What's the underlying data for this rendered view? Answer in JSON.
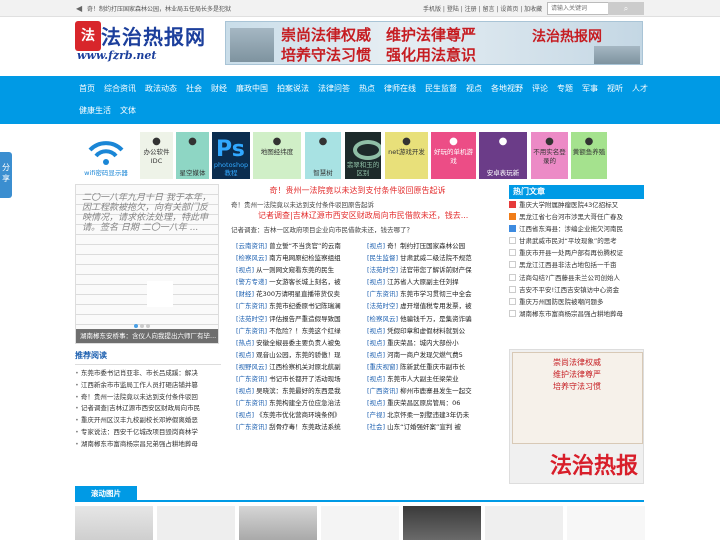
{
  "topbar": {
    "notice": "奇！制约打压国家森林公园，林业局五任局长多是犯狱",
    "links": "手机版 | 登陆 | 注册 | 留言 | 设首页 | 加收藏",
    "search_placeholder": "请输入关键词",
    "search_icon": "search-icon",
    "speaker_icon": "speaker-icon"
  },
  "logo": {
    "mark": "法",
    "name": "法治热报网",
    "url": "www.fzrb.net"
  },
  "banner": {
    "line1": "崇尚法律权威　维护法律尊严",
    "line2": "培养守法习惯　强化用法意识",
    "side": "法治热报网"
  },
  "nav": {
    "row1": [
      "首页",
      "综合资讯",
      "政法动态",
      "社会",
      "财经",
      "廉政中国",
      "拍案说法",
      "法律问答",
      "热点",
      "律师在线",
      "民生监督",
      "视点",
      "各地视野",
      "评论",
      "专题",
      "军事",
      "视听",
      "人才"
    ],
    "row2": [
      "健康生活",
      "文体"
    ]
  },
  "share": "分享",
  "tiles": [
    {
      "label": "wifi密码显示器",
      "icon": "wifi-icon",
      "bg": "#ffffff",
      "fg": "#1a86d6"
    },
    {
      "label": "办公软件\nIDC",
      "icon": "office-icon",
      "bg": "#eef3e8",
      "fg": "#333333"
    },
    {
      "label": "星空媒体",
      "icon": "star-icon",
      "bg": "#8ed6c4",
      "fg": "#333333"
    },
    {
      "label": "photoshop教程",
      "icon": "photoshop-icon",
      "bg": "#0b2d4f",
      "fg": "#31a8ff"
    },
    {
      "label": "地图经纬度",
      "icon": "map-icon",
      "bg": "#d0efc7",
      "fg": "#333333"
    },
    {
      "label": "智慧树",
      "icon": "tree-icon",
      "bg": "#a8e2e3",
      "fg": "#333333"
    },
    {
      "label": "翡翠和玉的区别",
      "icon": "jade-icon",
      "bg": "#1d2a2a",
      "fg": "#8fbfa6"
    },
    {
      "label": "net游戏开发",
      "icon": "game-dev-icon",
      "bg": "#e8e07a",
      "fg": "#333333"
    },
    {
      "label": "好玩的单机游戏",
      "icon": "game-icon",
      "bg": "#ec4d86",
      "fg": "#ffffff"
    },
    {
      "label": "安卓表玩新",
      "icon": "android-icon",
      "bg": "#6b3c88",
      "fg": "#ffffff"
    },
    {
      "label": "不用实名登录的",
      "icon": "login-icon",
      "bg": "#ec8ac6",
      "fg": "#333333"
    },
    {
      "label": "黄额鱼养殖",
      "icon": "fish-icon",
      "bg": "#a5e28e",
      "fg": "#333333"
    }
  ],
  "headline": {
    "title1": "奇！贵州一法院竟以未达到支付条件驳回原告起诉",
    "desc1": "奇！贵州一法院竟以未达到支付条件驳回原告起诉",
    "title2": "记者调查|吉林辽源市西安区财政局向市民借款未还，钱去...",
    "desc2": "记者调查：吉林一区政府项目企业向市民借款未还，钱去哪了？"
  },
  "slide": {
    "caption": "湖南郴东安桥事：含仪人向我提出六师厂有毕...",
    "scrawl": "二〇一八年九月十日 我于本年，因工程款被拖欠，向有关部门反映情况，请求依法处理，特此申请。签名 日期 二〇一八年 ..."
  },
  "recommend": {
    "title": "推荐阅读",
    "items": [
      "东莞市委书记肖亚非、市长吕成蹊：解决",
      "江西新余市市监局工作人员打砸店铺并篡",
      "奇！贵州一法院竟以未达到支付条件驳回",
      "记者调查|吉林辽源市西安区财政局向市民",
      "重庆开州区汉丰九校副校长邓婷假离婚恶",
      "专家说法：西安千亿城改项目毁岗商林学",
      "湖南郴东市富商杨宗昌兄弟强占耕地葬母"
    ]
  },
  "news_grid": [
    [
      {
        "tag": "[云南资讯]",
        "text": "曾立誓“不当贪官”的云南"
      },
      {
        "tag": "[视点]",
        "text": "奇！制约打压国家森林公园"
      }
    ],
    [
      {
        "tag": "[检察风云]",
        "text": "南方电网原纪检监察组组"
      },
      {
        "tag": "[民生监督]",
        "text": "甘肃武威二级法院不规范"
      }
    ],
    [
      {
        "tag": "[视点]",
        "text": "从一则网文窥看东莞的民生"
      },
      {
        "tag": "[法苑时空]",
        "text": "法官带您了解诉前财产保"
      }
    ],
    [
      {
        "tag": "[警方专递]",
        "text": "一女游客长城上刻名，被"
      },
      {
        "tag": "[视点]",
        "text": "江苏省人大原副主任刘捍"
      }
    ],
    [
      {
        "tag": "[财经]",
        "text": "花300万请明星直播带货仅卖"
      },
      {
        "tag": "[广东资讯]",
        "text": "东莞市学习贯彻三中全会"
      }
    ],
    [
      {
        "tag": "[广东资讯]",
        "text": "东莞市纪委原书记陈瑞澜"
      },
      {
        "tag": "[法苑时空]",
        "text": "虚开增值税专用发票，被"
      }
    ],
    [
      {
        "tag": "[法苑时空]",
        "text": "评估报告严重造假导致国"
      },
      {
        "tag": "[检察风云]",
        "text": "他骗钱千万，是集资诈骗"
      }
    ],
    [
      {
        "tag": "[广东资讯]",
        "text": "不危险？！东莞这个红绿"
      },
      {
        "tag": "[视点]",
        "text": "凭假印章和虚假材料就到公"
      }
    ],
    [
      {
        "tag": "[热点]",
        "text": "安徽全椒县委主要负责人被免"
      },
      {
        "tag": "[视点]",
        "text": "重庆荣昌：城内大部份小"
      }
    ],
    [
      {
        "tag": "[视点]",
        "text": "观音山公园，东莞的骄傲！现"
      },
      {
        "tag": "[视点]",
        "text": "河南一商户发现欠燃气费5"
      }
    ],
    [
      {
        "tag": "[视野风云]",
        "text": "江西检察机关对原北航副"
      },
      {
        "tag": "[重庆视窗]",
        "text": "陈新武任重庆市副市长"
      }
    ],
    [
      {
        "tag": "[广东资讯]",
        "text": "书记市长都开了活动现场"
      },
      {
        "tag": "[视点]",
        "text": "东莞市人大副主任梁荣业"
      }
    ],
    [
      {
        "tag": "[视点]",
        "text": "吴晓滨：东莞最好的东西是我"
      },
      {
        "tag": "[广西资讯]",
        "text": "柳州市鹿寨县发生一起交"
      }
    ],
    [
      {
        "tag": "[广东资讯]",
        "text": "东莞构建全方位应急治法"
      },
      {
        "tag": "[视点]",
        "text": "重庆荣昌区原房管局：06"
      }
    ],
    [
      {
        "tag": "[视点]",
        "text": "《东莞市优化营商环境条例》"
      },
      {
        "tag": "[产视]",
        "text": "北京怀柔一别墅违建3年仍未"
      }
    ],
    [
      {
        "tag": "[广东资讯]",
        "text": "刮骨疗毒！东莞政法系统"
      },
      {
        "tag": "[社会]",
        "text": "山东“订婚强奸案”宣判 被"
      }
    ]
  ],
  "hot": {
    "title": "热门文章",
    "items": [
      {
        "text": "重庆大学附属肿瘤医院43亿招标又",
        "color": "#e63b3b"
      },
      {
        "text": "黑龙江省七台河市涉黑大哥任广春及",
        "color": "#f07c18"
      },
      {
        "text": "江西省东海县：涉编企业拖欠河南民",
        "color": "#3d8be0"
      },
      {
        "text": "甘肃武威市民对“平坟现象”的思考",
        "color": "#ffffff"
      },
      {
        "text": "重庆市开县一处两户部有再份腾权证",
        "color": "#ffffff"
      },
      {
        "text": "黑龙江江西县非法占地包括一千亩",
        "color": "#ffffff"
      },
      {
        "text": "法商勾结?广西藤县未兰公司创始人",
        "color": "#ffffff"
      },
      {
        "text": "吉安不平安!江西吉安镇访中心资金",
        "color": "#ffffff"
      },
      {
        "text": "重庆万州国防医院被嘲问题多",
        "color": "#ffffff"
      },
      {
        "text": "湖南郴东市富商杨宗昌强占耕地葬母",
        "color": "#ffffff"
      }
    ]
  },
  "ad": {
    "l1": "崇尚法律权威",
    "l2": "维护法律尊严",
    "l3": "培养守法习惯",
    "big": "法治热报"
  },
  "scroll_title": "滚动图片",
  "colors": {
    "accent": "#009ae5",
    "headline_red": "#e32d2d",
    "logo_blue": "#1c3f9c"
  }
}
